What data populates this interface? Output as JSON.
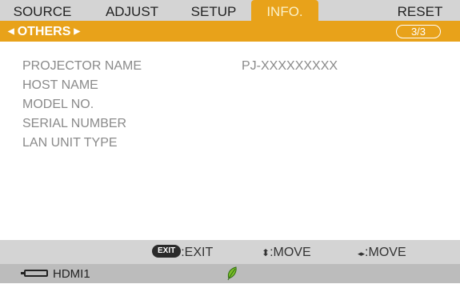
{
  "tabs": [
    {
      "label": "SOURCE",
      "active": false
    },
    {
      "label": "ADJUST",
      "active": false
    },
    {
      "label": "SETUP",
      "active": false
    },
    {
      "label": "INFO.",
      "active": true
    },
    {
      "label": "RESET",
      "active": false
    }
  ],
  "submenu": {
    "label": "OTHERS",
    "page": "3/3"
  },
  "info_rows": [
    {
      "label": "PROJECTOR NAME",
      "value": "PJ-XXXXXXXXX"
    },
    {
      "label": "HOST NAME",
      "value": ""
    },
    {
      "label": "MODEL NO.",
      "value": ""
    },
    {
      "label": "SERIAL NUMBER",
      "value": ""
    },
    {
      "label": "LAN UNIT TYPE",
      "value": ""
    }
  ],
  "help": {
    "exit_key": "EXIT",
    "exit_text": ":EXIT",
    "updown_glyph": "⬍",
    "updown_text": ":MOVE",
    "leftright_glyph": "◂▸",
    "leftright_text": ":MOVE"
  },
  "status": {
    "source": "HDMI1",
    "eco_icon": "leaf-icon",
    "icon_color": "#7bbf2a"
  },
  "colors": {
    "accent": "#e8a21a",
    "bar": "#d4d4d4",
    "status_bar": "#bcbcbc",
    "text_dim": "#8a8a8a"
  }
}
